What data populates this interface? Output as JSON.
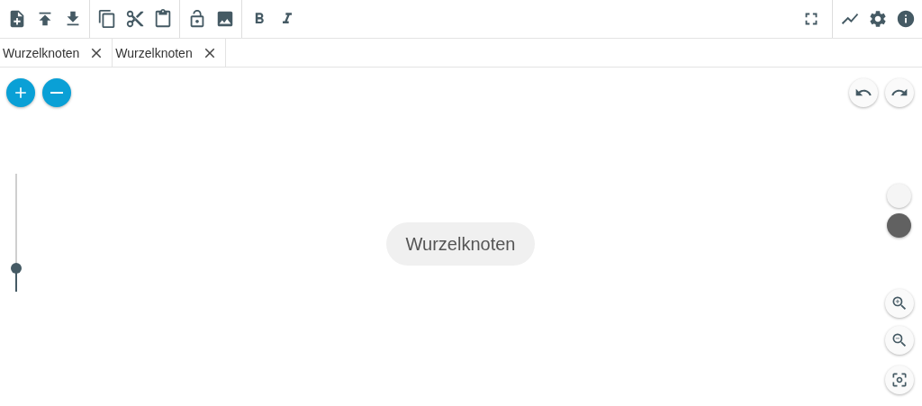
{
  "tabs": [
    {
      "label": "Wurzelknoten"
    },
    {
      "label": "Wurzelknoten"
    }
  ],
  "zoom_slider": {
    "level": 0.2
  },
  "color_swatches": [
    {
      "color": "#f5f5f5"
    },
    {
      "color": "#616161"
    }
  ],
  "node": {
    "label": "Wurzelknoten"
  }
}
